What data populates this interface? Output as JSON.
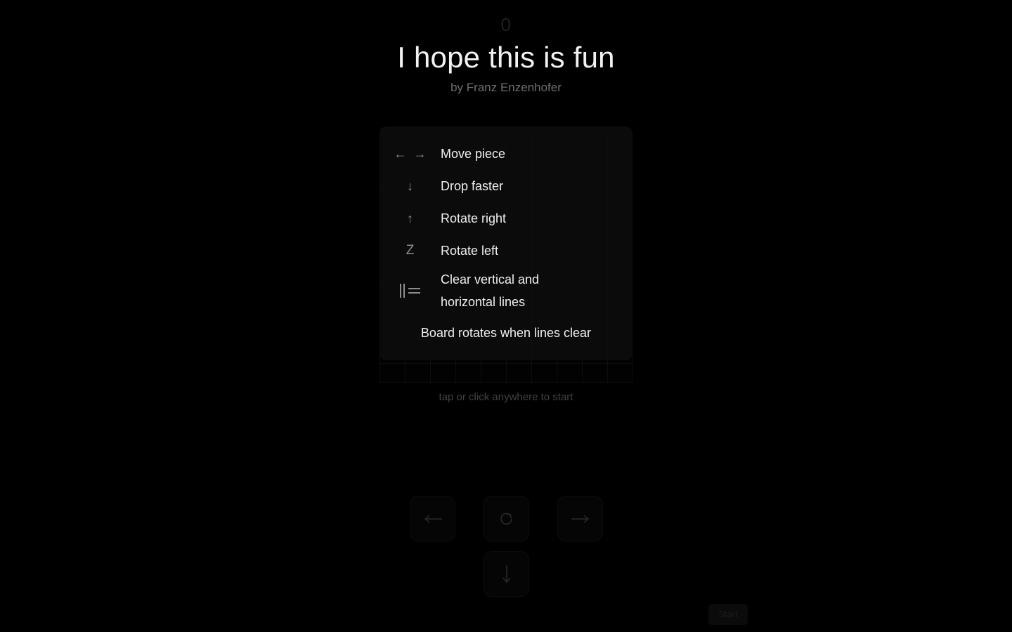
{
  "game": {
    "score": "0",
    "title": "I hope this is fun",
    "byline": "by Franz Enzenhofer",
    "start_hint": "tap or click anywhere to start",
    "start_button_label": "Start"
  },
  "instructions": {
    "rows": [
      {
        "keys": "← →",
        "key_icons": [
          "arrow-left",
          "arrow-right"
        ],
        "description": "Move piece"
      },
      {
        "keys": "↓",
        "key_icons": [
          "arrow-down"
        ],
        "description": "Drop faster"
      },
      {
        "keys": "↑",
        "key_icons": [
          "arrow-up"
        ],
        "description": "Rotate right"
      },
      {
        "keys": "Z",
        "key_icons": [
          "key-z"
        ],
        "description": "Rotate left"
      },
      {
        "keys": "‖=",
        "key_icons": [
          "vertical-horizontal-lines"
        ],
        "description": "Clear vertical and horizontal lines"
      }
    ],
    "note": "Board rotates when lines clear"
  },
  "touch_controls": [
    {
      "name": "move-left",
      "icon": "arrow-left"
    },
    {
      "name": "rotate",
      "icon": "rotate-clockwise"
    },
    {
      "name": "move-right",
      "icon": "arrow-right"
    },
    {
      "name": "drop-faster",
      "icon": "arrow-down"
    }
  ],
  "board": {
    "columns": 10,
    "rows": 10,
    "cell_size_px": 36
  },
  "colors": {
    "background": "#000000",
    "panel": "#0e0e0e",
    "text": "#f0f0f0",
    "muted_text": "#6e6e6e",
    "dim_text": "#1f1f1f",
    "grid_line": "#1a1a1a"
  }
}
